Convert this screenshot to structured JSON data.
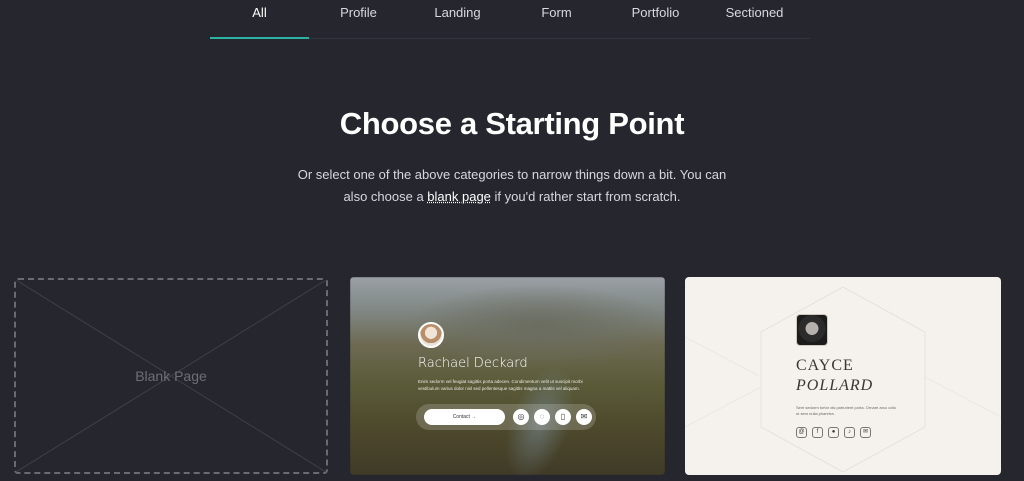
{
  "tabs": [
    {
      "label": "All",
      "active": true
    },
    {
      "label": "Profile"
    },
    {
      "label": "Landing"
    },
    {
      "label": "Form"
    },
    {
      "label": "Portfolio"
    },
    {
      "label": "Sectioned"
    }
  ],
  "hero": {
    "title": "Choose a Starting Point",
    "subtitle_before": "Or select one of the above categories to narrow things down a bit. You can also choose a ",
    "subtitle_link": "blank page",
    "subtitle_after": " if you'd rather start from scratch."
  },
  "cards": {
    "blank": {
      "label": "Blank Page"
    },
    "profile": {
      "name": "Rachael Deckard",
      "bio": "Enim sedorm vel feugiat sagittis porta adecen. Condimentum velit ut suscipit morbi vestibulum varius dolor nisl sed pellentesque sagittis magna a mattis vel aliquam.",
      "button_label": "Contact",
      "icons": [
        "instagram-icon",
        "chat-icon",
        "phone-icon",
        "mail-icon"
      ]
    },
    "cayce": {
      "first_name": "CAYCE",
      "last_name": "POLLARD",
      "bio": "Sem sedorm tortor dis parturient porta. Ornare arcu odio ut sem nulla pharetra.",
      "icons": [
        "threads-icon",
        "facebook-icon",
        "github-icon",
        "tiktok-icon",
        "mail-icon"
      ]
    }
  },
  "colors": {
    "background": "#26262f",
    "accent": "#2bb3a2"
  }
}
